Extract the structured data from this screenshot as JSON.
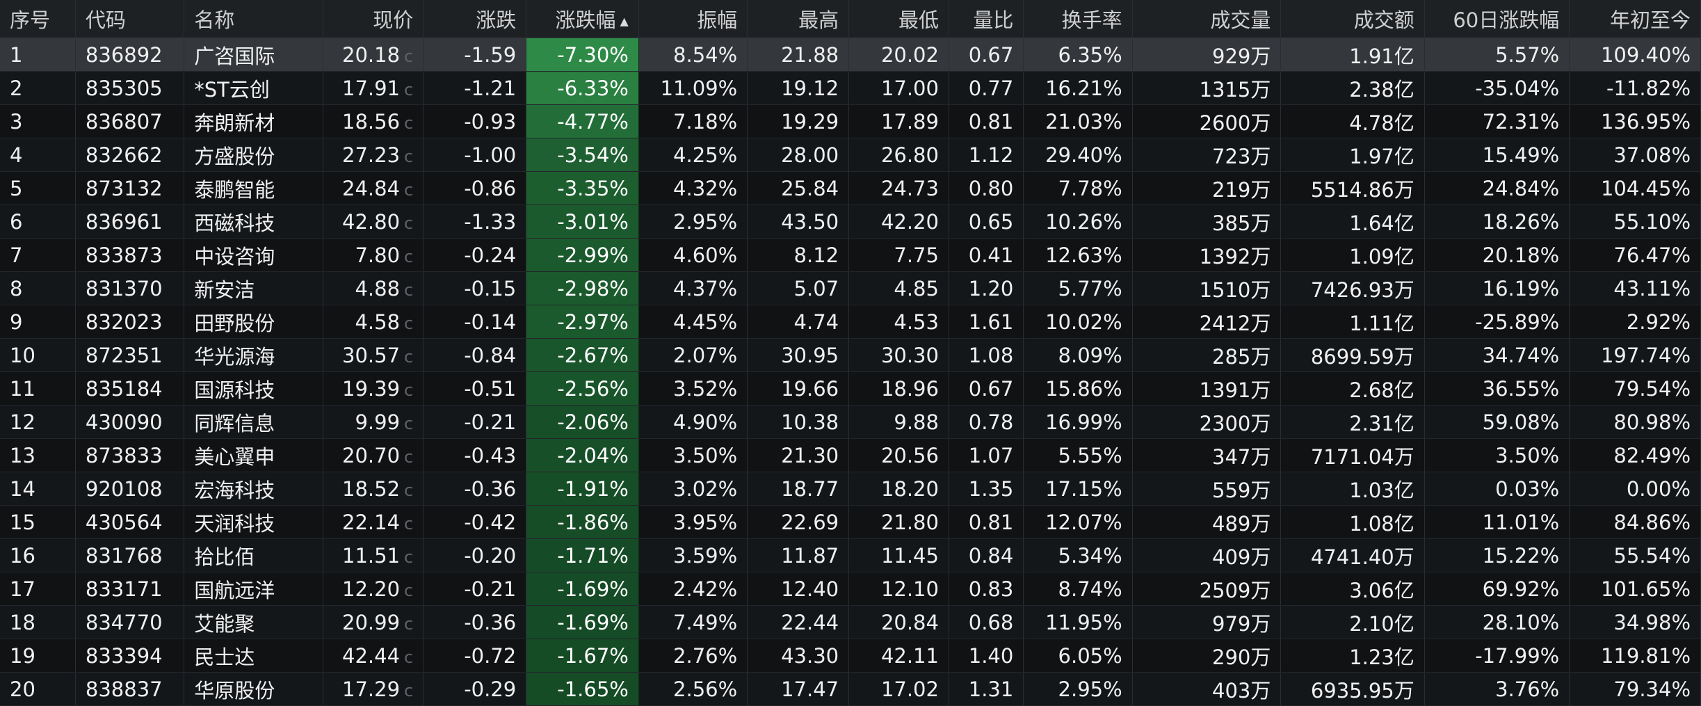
{
  "columns": [
    {
      "key": "idx",
      "label": "序号"
    },
    {
      "key": "code",
      "label": "代码"
    },
    {
      "key": "name",
      "label": "名称"
    },
    {
      "key": "price",
      "label": "现价"
    },
    {
      "key": "change",
      "label": "涨跌"
    },
    {
      "key": "pct",
      "label": "涨跌幅",
      "sort_indicator": "▲"
    },
    {
      "key": "amplitude",
      "label": "振幅"
    },
    {
      "key": "high",
      "label": "最高"
    },
    {
      "key": "low",
      "label": "最低"
    },
    {
      "key": "vol_ratio",
      "label": "量比"
    },
    {
      "key": "turnover",
      "label": "换手率"
    },
    {
      "key": "volume",
      "label": "成交量"
    },
    {
      "key": "amount",
      "label": "成交额"
    },
    {
      "key": "chg60",
      "label": "60日涨跌幅"
    },
    {
      "key": "ytd",
      "label": "年初至今"
    }
  ],
  "price_flag_text": "c",
  "colors": {
    "up": "#ff3b3f",
    "down": "#2dcc5a",
    "background": "#101214",
    "header_background": "#1e2124",
    "selected_row": "#34373c"
  },
  "rows": [
    {
      "idx": "1",
      "code": "836892",
      "name": "广咨国际",
      "price": "20.18",
      "change": "-1.59",
      "pct": "-7.30%",
      "amplitude": "8.54%",
      "high": "21.88",
      "low": "20.02",
      "vol_ratio": "0.67",
      "turnover": "6.35%",
      "volume": "929万",
      "amount": "1.91亿",
      "chg60": "5.57%",
      "ytd": "109.40%"
    },
    {
      "idx": "2",
      "code": "835305",
      "name": "*ST云创",
      "price": "17.91",
      "change": "-1.21",
      "pct": "-6.33%",
      "amplitude": "11.09%",
      "high": "19.12",
      "low": "17.00",
      "vol_ratio": "0.77",
      "turnover": "16.21%",
      "volume": "1315万",
      "amount": "2.38亿",
      "chg60": "-35.04%",
      "ytd": "-11.82%"
    },
    {
      "idx": "3",
      "code": "836807",
      "name": "奔朗新材",
      "price": "18.56",
      "change": "-0.93",
      "pct": "-4.77%",
      "amplitude": "7.18%",
      "high": "19.29",
      "low": "17.89",
      "vol_ratio": "0.81",
      "turnover": "21.03%",
      "volume": "2600万",
      "amount": "4.78亿",
      "chg60": "72.31%",
      "ytd": "136.95%"
    },
    {
      "idx": "4",
      "code": "832662",
      "name": "方盛股份",
      "price": "27.23",
      "change": "-1.00",
      "pct": "-3.54%",
      "amplitude": "4.25%",
      "high": "28.00",
      "low": "26.80",
      "vol_ratio": "1.12",
      "turnover": "29.40%",
      "volume": "723万",
      "amount": "1.97亿",
      "chg60": "15.49%",
      "ytd": "37.08%"
    },
    {
      "idx": "5",
      "code": "873132",
      "name": "泰鹏智能",
      "price": "24.84",
      "change": "-0.86",
      "pct": "-3.35%",
      "amplitude": "4.32%",
      "high": "25.84",
      "low": "24.73",
      "vol_ratio": "0.80",
      "turnover": "7.78%",
      "volume": "219万",
      "amount": "5514.86万",
      "chg60": "24.84%",
      "ytd": "104.45%"
    },
    {
      "idx": "6",
      "code": "836961",
      "name": "西磁科技",
      "price": "42.80",
      "change": "-1.33",
      "pct": "-3.01%",
      "amplitude": "2.95%",
      "high": "43.50",
      "low": "42.20",
      "vol_ratio": "0.65",
      "turnover": "10.26%",
      "volume": "385万",
      "amount": "1.64亿",
      "chg60": "18.26%",
      "ytd": "55.10%"
    },
    {
      "idx": "7",
      "code": "833873",
      "name": "中设咨询",
      "price": "7.80",
      "change": "-0.24",
      "pct": "-2.99%",
      "amplitude": "4.60%",
      "high": "8.12",
      "low": "7.75",
      "vol_ratio": "0.41",
      "turnover": "12.63%",
      "volume": "1392万",
      "amount": "1.09亿",
      "chg60": "20.18%",
      "ytd": "76.47%"
    },
    {
      "idx": "8",
      "code": "831370",
      "name": "新安洁",
      "price": "4.88",
      "change": "-0.15",
      "pct": "-2.98%",
      "amplitude": "4.37%",
      "high": "5.07",
      "low": "4.85",
      "vol_ratio": "1.20",
      "turnover": "5.77%",
      "volume": "1510万",
      "amount": "7426.93万",
      "chg60": "16.19%",
      "ytd": "43.11%"
    },
    {
      "idx": "9",
      "code": "832023",
      "name": "田野股份",
      "price": "4.58",
      "change": "-0.14",
      "pct": "-2.97%",
      "amplitude": "4.45%",
      "high": "4.74",
      "low": "4.53",
      "vol_ratio": "1.61",
      "turnover": "10.02%",
      "volume": "2412万",
      "amount": "1.11亿",
      "chg60": "-25.89%",
      "ytd": "2.92%"
    },
    {
      "idx": "10",
      "code": "872351",
      "name": "华光源海",
      "price": "30.57",
      "change": "-0.84",
      "pct": "-2.67%",
      "amplitude": "2.07%",
      "high": "30.95",
      "low": "30.30",
      "vol_ratio": "1.08",
      "turnover": "8.09%",
      "volume": "285万",
      "amount": "8699.59万",
      "chg60": "34.74%",
      "ytd": "197.74%"
    },
    {
      "idx": "11",
      "code": "835184",
      "name": "国源科技",
      "price": "19.39",
      "change": "-0.51",
      "pct": "-2.56%",
      "amplitude": "3.52%",
      "high": "19.66",
      "low": "18.96",
      "vol_ratio": "0.67",
      "turnover": "15.86%",
      "volume": "1391万",
      "amount": "2.68亿",
      "chg60": "36.55%",
      "ytd": "79.54%"
    },
    {
      "idx": "12",
      "code": "430090",
      "name": "同辉信息",
      "price": "9.99",
      "change": "-0.21",
      "pct": "-2.06%",
      "amplitude": "4.90%",
      "high": "10.38",
      "low": "9.88",
      "vol_ratio": "0.78",
      "turnover": "16.99%",
      "volume": "2300万",
      "amount": "2.31亿",
      "chg60": "59.08%",
      "ytd": "80.98%"
    },
    {
      "idx": "13",
      "code": "873833",
      "name": "美心翼申",
      "price": "20.70",
      "change": "-0.43",
      "pct": "-2.04%",
      "amplitude": "3.50%",
      "high": "21.30",
      "low": "20.56",
      "vol_ratio": "1.07",
      "turnover": "5.55%",
      "volume": "347万",
      "amount": "7171.04万",
      "chg60": "3.50%",
      "ytd": "82.49%"
    },
    {
      "idx": "14",
      "code": "920108",
      "name": "宏海科技",
      "price": "18.52",
      "change": "-0.36",
      "pct": "-1.91%",
      "amplitude": "3.02%",
      "high": "18.77",
      "low": "18.20",
      "vol_ratio": "1.35",
      "turnover": "17.15%",
      "volume": "559万",
      "amount": "1.03亿",
      "chg60": "0.03%",
      "ytd": "0.00%"
    },
    {
      "idx": "15",
      "code": "430564",
      "name": "天润科技",
      "price": "22.14",
      "change": "-0.42",
      "pct": "-1.86%",
      "amplitude": "3.95%",
      "high": "22.69",
      "low": "21.80",
      "vol_ratio": "0.81",
      "turnover": "12.07%",
      "volume": "489万",
      "amount": "1.08亿",
      "chg60": "11.01%",
      "ytd": "84.86%"
    },
    {
      "idx": "16",
      "code": "831768",
      "name": "拾比佰",
      "price": "11.51",
      "change": "-0.20",
      "pct": "-1.71%",
      "amplitude": "3.59%",
      "high": "11.87",
      "low": "11.45",
      "vol_ratio": "0.84",
      "turnover": "5.34%",
      "volume": "409万",
      "amount": "4741.40万",
      "chg60": "15.22%",
      "ytd": "55.54%"
    },
    {
      "idx": "17",
      "code": "833171",
      "name": "国航远洋",
      "price": "12.20",
      "change": "-0.21",
      "pct": "-1.69%",
      "amplitude": "2.42%",
      "high": "12.40",
      "low": "12.10",
      "vol_ratio": "0.83",
      "turnover": "8.74%",
      "volume": "2509万",
      "amount": "3.06亿",
      "chg60": "69.92%",
      "ytd": "101.65%"
    },
    {
      "idx": "18",
      "code": "834770",
      "name": "艾能聚",
      "price": "20.99",
      "change": "-0.36",
      "pct": "-1.69%",
      "amplitude": "7.49%",
      "high": "22.44",
      "low": "20.84",
      "vol_ratio": "0.68",
      "turnover": "11.95%",
      "volume": "979万",
      "amount": "2.10亿",
      "chg60": "28.10%",
      "ytd": "34.98%"
    },
    {
      "idx": "19",
      "code": "833394",
      "name": "民士达",
      "price": "42.44",
      "change": "-0.72",
      "pct": "-1.67%",
      "amplitude": "2.76%",
      "high": "43.30",
      "low": "42.11",
      "vol_ratio": "1.40",
      "turnover": "6.05%",
      "volume": "290万",
      "amount": "1.23亿",
      "chg60": "-17.99%",
      "ytd": "119.81%"
    },
    {
      "idx": "20",
      "code": "838837",
      "name": "华原股份",
      "price": "17.29",
      "change": "-0.29",
      "pct": "-1.65%",
      "amplitude": "2.56%",
      "high": "17.47",
      "low": "17.02",
      "vol_ratio": "1.31",
      "turnover": "2.95%",
      "volume": "403万",
      "amount": "6935.95万",
      "chg60": "3.76%",
      "ytd": "79.34%"
    }
  ]
}
